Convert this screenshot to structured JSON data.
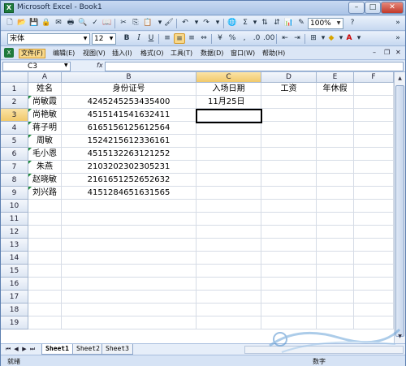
{
  "window": {
    "title": "Microsoft Excel - Book1"
  },
  "toolbar": {
    "zoom": "100%",
    "font_name": "宋体",
    "font_size": "12"
  },
  "menu": {
    "items": [
      "文件(F)",
      "编辑(E)",
      "视图(V)",
      "插入(I)",
      "格式(O)",
      "工具(T)",
      "数据(D)",
      "窗口(W)",
      "帮助(H)"
    ]
  },
  "formula_bar": {
    "name_box": "C3",
    "fx": "fx",
    "formula": ""
  },
  "columns": [
    "A",
    "B",
    "C",
    "D",
    "E",
    "F"
  ],
  "rows": [
    "1",
    "2",
    "3",
    "4",
    "5",
    "6",
    "7",
    "8",
    "9",
    "10",
    "11",
    "12",
    "13",
    "14",
    "15",
    "16",
    "17",
    "18",
    "19"
  ],
  "sheet": {
    "headers": {
      "A": "姓名",
      "B": "身份证号",
      "C": "入场日期",
      "D": "工资",
      "E": "年休假"
    },
    "data": [
      {
        "name": "尚敏霞",
        "id": "4245245253435400",
        "date": "11月25日"
      },
      {
        "name": "尚艳敏",
        "id": "4515141541632411",
        "date": ""
      },
      {
        "name": "蒋子明",
        "id": "6165156125612564",
        "date": ""
      },
      {
        "name": "周敏",
        "id": "1524215612336161",
        "date": ""
      },
      {
        "name": "毛小恩",
        "id": "4515132263121252",
        "date": ""
      },
      {
        "name": "朱燕",
        "id": "2103202302305231",
        "date": ""
      },
      {
        "name": "赵晓敏",
        "id": "2161651252652632",
        "date": ""
      },
      {
        "name": "刘兴路",
        "id": "4151284651631565",
        "date": ""
      }
    ]
  },
  "tabs": [
    "Sheet1",
    "Sheet2",
    "Sheet3"
  ],
  "status": {
    "ready": "就绪",
    "num": "数字"
  },
  "colors": {
    "accent": "#d59a2a",
    "excel_green": "#1e7a3c",
    "grid_line": "#d6dce6"
  }
}
